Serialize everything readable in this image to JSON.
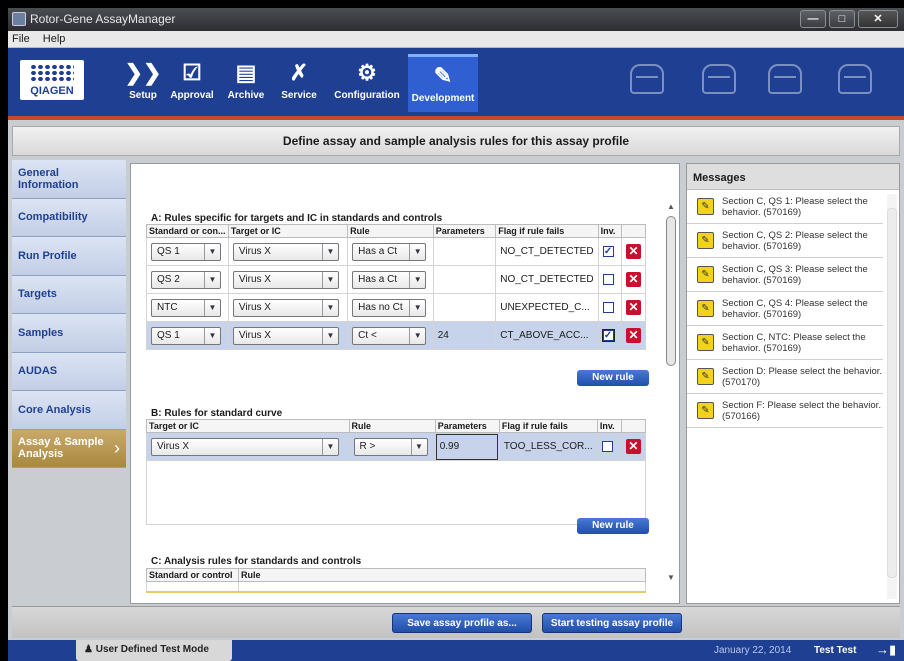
{
  "app": {
    "title": "Rotor-Gene AssayManager"
  },
  "menu": [
    "File",
    "Help"
  ],
  "logo_text": "QIAGEN",
  "nav": [
    {
      "label": "Setup",
      "icon": "setup-icon"
    },
    {
      "label": "Approval",
      "icon": "approval-icon"
    },
    {
      "label": "Archive",
      "icon": "archive-icon"
    },
    {
      "label": "Service",
      "icon": "service-icon"
    },
    {
      "label": "Configuration",
      "icon": "configuration-icon"
    },
    {
      "label": "Development",
      "icon": "development-icon",
      "active": true
    }
  ],
  "header": "Define assay and sample analysis rules for this assay profile",
  "sidebar": [
    "General Information",
    "Compatibility",
    "Run Profile",
    "Targets",
    "Samples",
    "AUDAS",
    "Core Analysis",
    "Assay & Sample Analysis"
  ],
  "sectionA": {
    "title": "A: Rules specific for targets and IC in standards and controls",
    "headers": [
      "Standard or con...",
      "Target or IC",
      "Rule",
      "Parameters",
      "Flag if rule fails",
      "Inv."
    ],
    "rows": [
      {
        "std": "QS 1",
        "target": "Virus X",
        "rule": "Has a Ct",
        "param": "",
        "flag": "NO_CT_DETECTED",
        "inv": true,
        "selected": false
      },
      {
        "std": "QS 2",
        "target": "Virus X",
        "rule": "Has a Ct",
        "param": "",
        "flag": "NO_CT_DETECTED",
        "inv": false,
        "selected": false
      },
      {
        "std": "NTC",
        "target": "Virus X",
        "rule": "Has no Ct",
        "param": "",
        "flag": "UNEXPECTED_C...",
        "inv": false,
        "selected": false
      },
      {
        "std": "QS 1",
        "target": "Virus X",
        "rule": "Ct <",
        "param": "24",
        "flag": "CT_ABOVE_ACC...",
        "inv": true,
        "selected": true
      }
    ],
    "new_rule": "New rule"
  },
  "sectionB": {
    "title": "B: Rules for standard curve",
    "headers": [
      "Target or IC",
      "Rule",
      "Parameters",
      "Flag if rule fails",
      "Inv."
    ],
    "rows": [
      {
        "target": "Virus X",
        "rule": "R >",
        "param": "0.99",
        "flag": "TOO_LESS_COR...",
        "inv": false
      }
    ],
    "new_rule": "New rule"
  },
  "sectionC": {
    "title": "C: Analysis rules for standards and controls",
    "headers": [
      "Standard or control",
      "Rule"
    ]
  },
  "messages": {
    "title": "Messages",
    "items": [
      "Section C, QS 1: Please select the behavior. (570169)",
      "Section C, QS 2: Please select the behavior. (570169)",
      "Section C, QS 3: Please select the behavior. (570169)",
      "Section C, QS 4: Please select the behavior. (570169)",
      "Section C, NTC: Please select the behavior. (570169)",
      "Section D: Please select the behavior. (570170)",
      "Section F: Please select the behavior. (570166)"
    ]
  },
  "buttons": {
    "save": "Save assay profile as...",
    "start": "Start testing assay profile"
  },
  "status": {
    "mode": "User Defined Test Mode",
    "date": "January 22, 2014",
    "user": "Test Test"
  },
  "colors": {
    "nav_bg": "#1f3f93",
    "accent": "#c84a28",
    "active_side": "#b89a52",
    "delete": "#c8102e",
    "warning": "#f2d21b"
  }
}
